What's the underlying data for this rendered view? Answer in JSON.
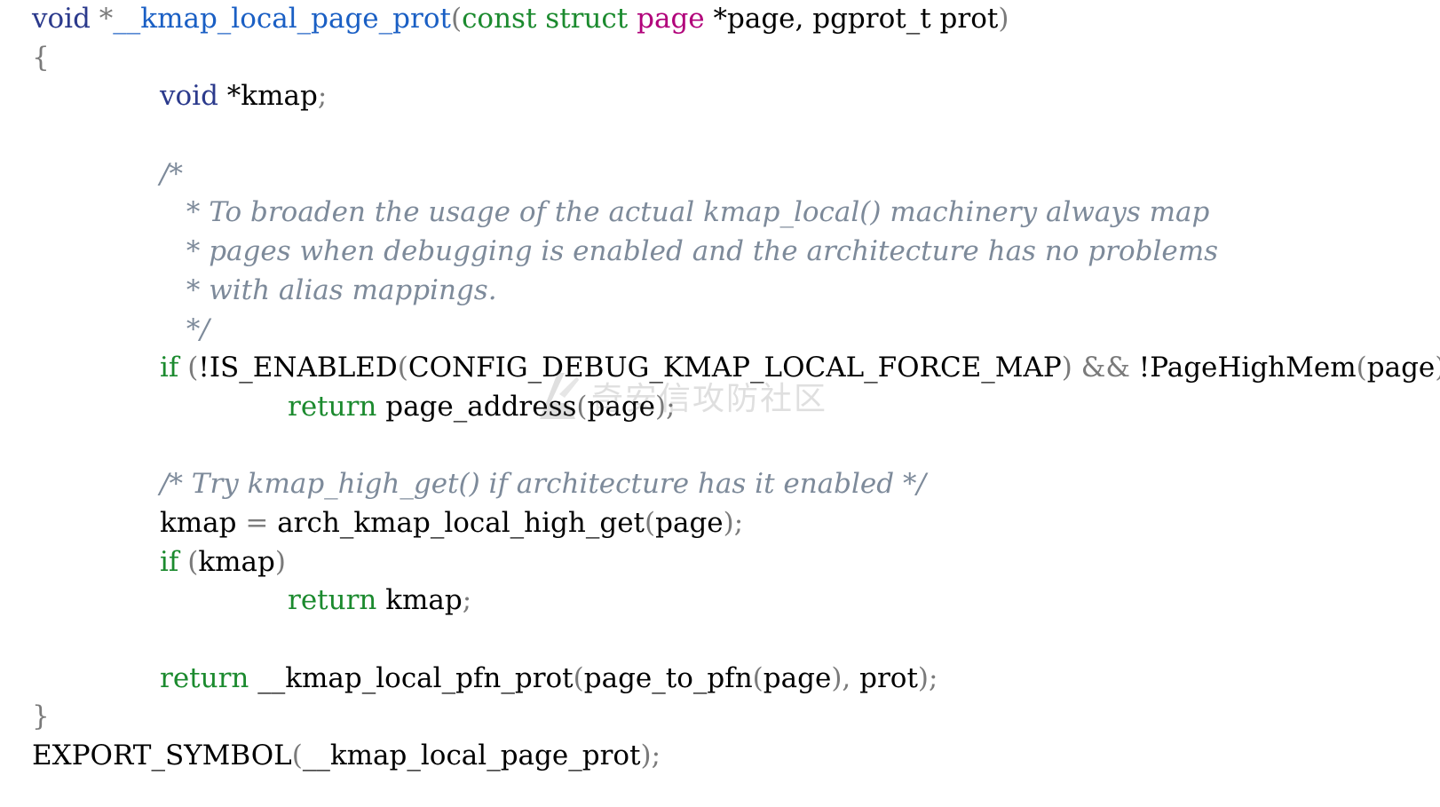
{
  "code": {
    "l1": {
      "void": "void",
      "star": " *",
      "fn": "__kmap_local_page_prot",
      "open": "(",
      "const": "const",
      "struct": "struct",
      "page": "page",
      "param1": " *page, ",
      "pgprot_t": "pgprot_t",
      "prot": " prot",
      "close": ")"
    },
    "l2": {
      "brace": "{"
    },
    "l3": {
      "void": "void",
      "rest": " *kmap",
      "semi": ";"
    },
    "comment_block": [
      "/*",
      " * To broaden the usage of the actual kmap_local() machinery always map",
      " * pages when debugging is enabled and the architecture has no problems",
      " * with alias mappings.",
      " */"
    ],
    "l9": {
      "if": "if",
      "p1": " (",
      "not1": "!",
      "is_enabled": "IS_ENABLED",
      "p2": "(",
      "config": "CONFIG_DEBUG_KMAP_LOCAL_FORCE_MAP",
      "p3": ") && ",
      "not2": "!",
      "highmem": "PageHighMem",
      "p4": "(",
      "arg": "page",
      "p5": "))"
    },
    "l10": {
      "return": "return",
      "fn": " page_address",
      "p1": "(",
      "arg": "page",
      "p2": ");"
    },
    "l12": {
      "comment": "/* Try kmap_high_get() if architecture has it enabled */"
    },
    "l13": {
      "var": "kmap",
      "eq": " = ",
      "fn": "arch_kmap_local_high_get",
      "p1": "(",
      "arg": "page",
      "p2": ");"
    },
    "l14": {
      "if": "if",
      "p1": " (",
      "arg": "kmap",
      "p2": ")"
    },
    "l15": {
      "return": "return",
      "arg": " kmap",
      "semi": ";"
    },
    "l17": {
      "return": "return",
      "fn": " __kmap_local_pfn_prot",
      "p1": "(",
      "fn2": "page_to_pfn",
      "p2": "(",
      "arg": "page",
      "p3": "), ",
      "arg2": "prot",
      "p4": ");"
    },
    "l18": {
      "brace": "}"
    },
    "l19": {
      "macro": "EXPORT_SYMBOL",
      "p1": "(",
      "arg": "__kmap_local_page_prot",
      "p2": ");"
    }
  },
  "watermark": {
    "text": "奇安信攻防社区"
  },
  "colors": {
    "keyword_type": "#2b3a8c",
    "keyword_green": "#1b8a2e",
    "keyword_purple": "#b1007a",
    "function_name": "#1a5fc4",
    "comment": "#7d8a9a",
    "punctuation": "#7a7a7a"
  }
}
